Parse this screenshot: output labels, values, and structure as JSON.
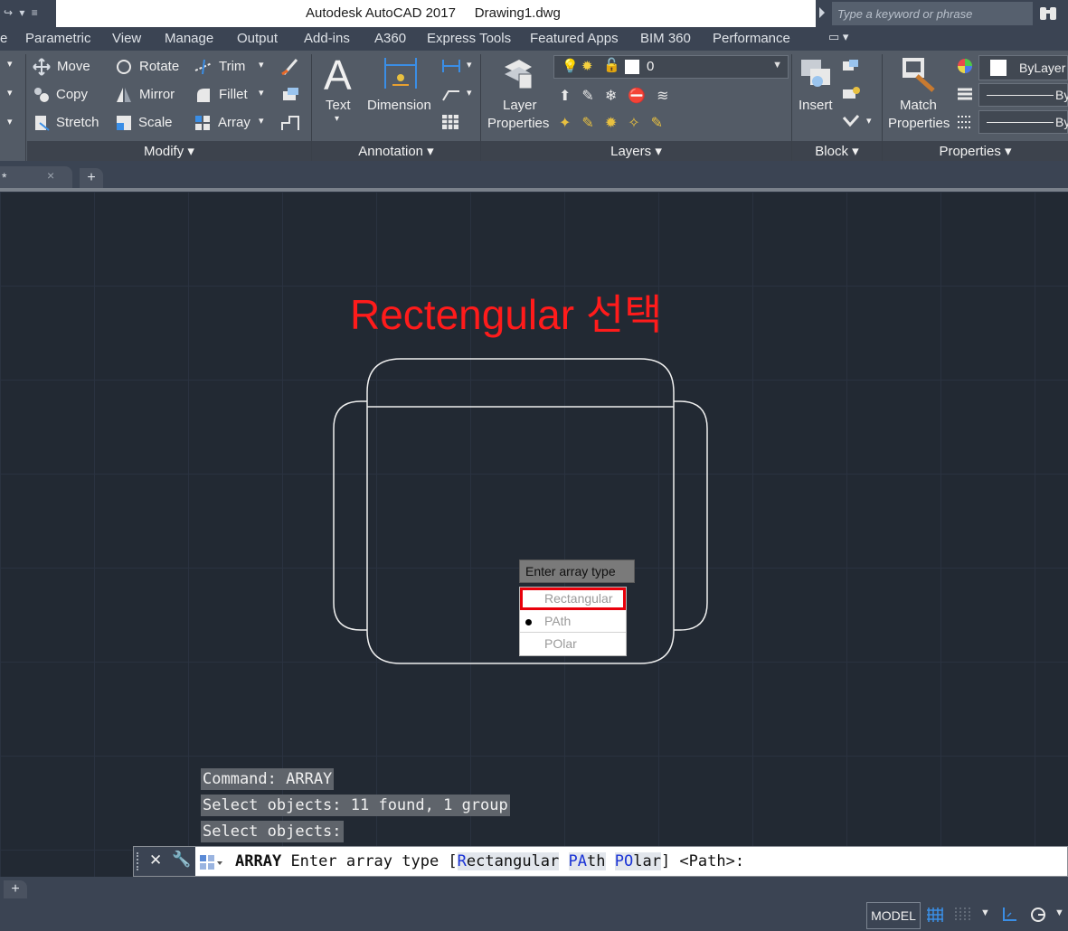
{
  "titlebar": {
    "app_title": "Autodesk AutoCAD 2017",
    "file_name": "Drawing1.dwg",
    "search_placeholder": "Type a keyword or phrase"
  },
  "menu": [
    "Parametric",
    "View",
    "Manage",
    "Output",
    "Add-ins",
    "A360",
    "Express Tools",
    "Featured Apps",
    "BIM 360",
    "Performance"
  ],
  "ribbon": {
    "modify": {
      "title": "Modify",
      "move": "Move",
      "copy": "Copy",
      "stretch": "Stretch",
      "rotate": "Rotate",
      "mirror": "Mirror",
      "scale": "Scale",
      "trim": "Trim",
      "fillet": "Fillet",
      "array": "Array"
    },
    "annotation": {
      "title": "Annotation",
      "text": "Text",
      "dimension": "Dimension"
    },
    "layers": {
      "title": "Layers",
      "layer_properties_1": "Layer",
      "layer_properties_2": "Properties",
      "current_layer": "0"
    },
    "block": {
      "title": "Block",
      "insert": "Insert"
    },
    "properties": {
      "title": "Properties",
      "match_1": "Match",
      "match_2": "Properties",
      "color": "ByLayer",
      "linetype": "By",
      "lineweight": "By"
    }
  },
  "tabs": {
    "doc_tab": "*",
    "close": "×",
    "new_tab": "+"
  },
  "canvas": {
    "annotation_heading": "Rectengular 선택",
    "tooltip": "Enter array type",
    "options": [
      {
        "label": "Rectangular",
        "selected": false,
        "highlighted": true
      },
      {
        "label": "PAth",
        "selected": true,
        "highlighted": false
      },
      {
        "label": "POlar",
        "selected": false,
        "highlighted": false
      }
    ]
  },
  "command_history": [
    "Command: ARRAY",
    "Select objects: 11 found, 1 group",
    "Select objects:"
  ],
  "command_line": {
    "command": "ARRAY",
    "prompt": "Enter array type [",
    "opt1_key": "R",
    "opt1_rest": "ectangular",
    "opt2_key": "PA",
    "opt2_rest": "th",
    "opt3_key": "PO",
    "opt3_rest": "lar",
    "suffix": "] <Path>:"
  },
  "status": {
    "model": "MODEL",
    "plus": "+"
  }
}
